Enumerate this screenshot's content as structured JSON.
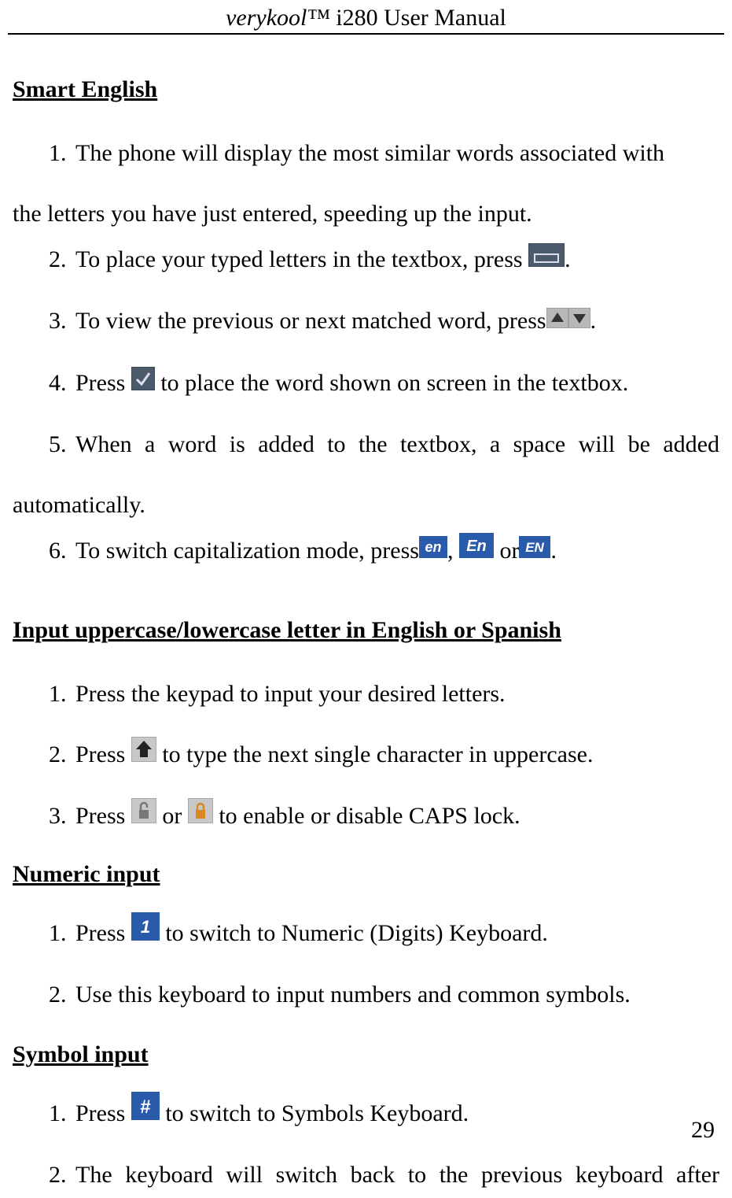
{
  "header": {
    "title_italic": "verykool™",
    "title_rest": " i280 User Manual"
  },
  "page_number": "29",
  "sections": [
    {
      "heading": "Smart English",
      "items": [
        {
          "num": "1.",
          "text_before": "The phone will display the most similar words associated with",
          "continuation": "the letters you have just entered, speeding up the input."
        },
        {
          "num": "2.",
          "text_before": "To place your typed letters in the textbox, press ",
          "icon": "space-key-icon",
          "text_after": "."
        },
        {
          "num": "3.",
          "text_before": "To view the previous or next matched word, press",
          "icon": "up-down-arrows-icon",
          "text_after": "."
        },
        {
          "num": "4.",
          "text_before": "Press ",
          "icon": "check-key-icon",
          "text_after": " to place the word shown on screen in the textbox."
        },
        {
          "num": "5.",
          "text_before": "When a word is added to the textbox, a space will be added",
          "continuation": "automatically."
        },
        {
          "num": "6.",
          "text_before": "To switch capitalization mode, press",
          "icons_seq": [
            "en-lower-icon",
            ", ",
            "en-mixed-icon",
            " or",
            "en-upper-icon",
            "."
          ]
        }
      ]
    },
    {
      "heading": "Input uppercase/lowercase letter in English or Spanish",
      "items": [
        {
          "num": "1.",
          "text_before": "Press the keypad to input your desired letters."
        },
        {
          "num": "2.",
          "text_before": "Press ",
          "icon": "shift-up-icon",
          "text_after": " to type the next single character in uppercase."
        },
        {
          "num": "3.",
          "text_before": "Press ",
          "icons_seq": [
            "lock-open-icon",
            " or ",
            "lock-closed-icon",
            " to enable or disable CAPS lock."
          ]
        }
      ]
    },
    {
      "heading": "Numeric input",
      "items": [
        {
          "num": "1.",
          "text_before": "Press ",
          "icon": "one-key-icon",
          "text_after": " to switch to Numeric (Digits) Keyboard."
        },
        {
          "num": "2.",
          "text_before": "Use this keyboard to input numbers and common symbols."
        }
      ]
    },
    {
      "heading": "Symbol input",
      "items": [
        {
          "num": "1.",
          "text_before": "Press ",
          "icon": "hash-key-icon",
          "text_after": " to switch to Symbols Keyboard."
        },
        {
          "num": "2.",
          "text_before": "The keyboard will switch back to the previous keyboard after"
        }
      ]
    }
  ]
}
